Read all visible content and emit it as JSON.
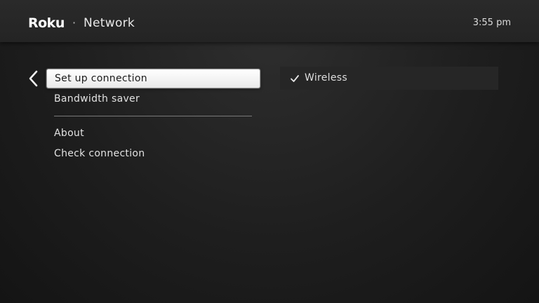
{
  "header": {
    "brand": "Roku",
    "separator": "·",
    "section": "Network",
    "clock": "3:55 pm"
  },
  "icons": {
    "back": "chevron-left-icon",
    "check": "checkmark-icon"
  },
  "menu": {
    "items": [
      {
        "label": "Set up connection",
        "selected": true
      },
      {
        "label": "Bandwidth saver",
        "selected": false
      },
      {
        "label": "About",
        "selected": false
      },
      {
        "label": "Check connection",
        "selected": false
      }
    ]
  },
  "detail": {
    "option_label": "Wireless",
    "checked": true
  },
  "colors": {
    "background": "#1c1c1c",
    "header": "#272727",
    "selection": "#ffffff",
    "text": "#e2e2e2"
  }
}
